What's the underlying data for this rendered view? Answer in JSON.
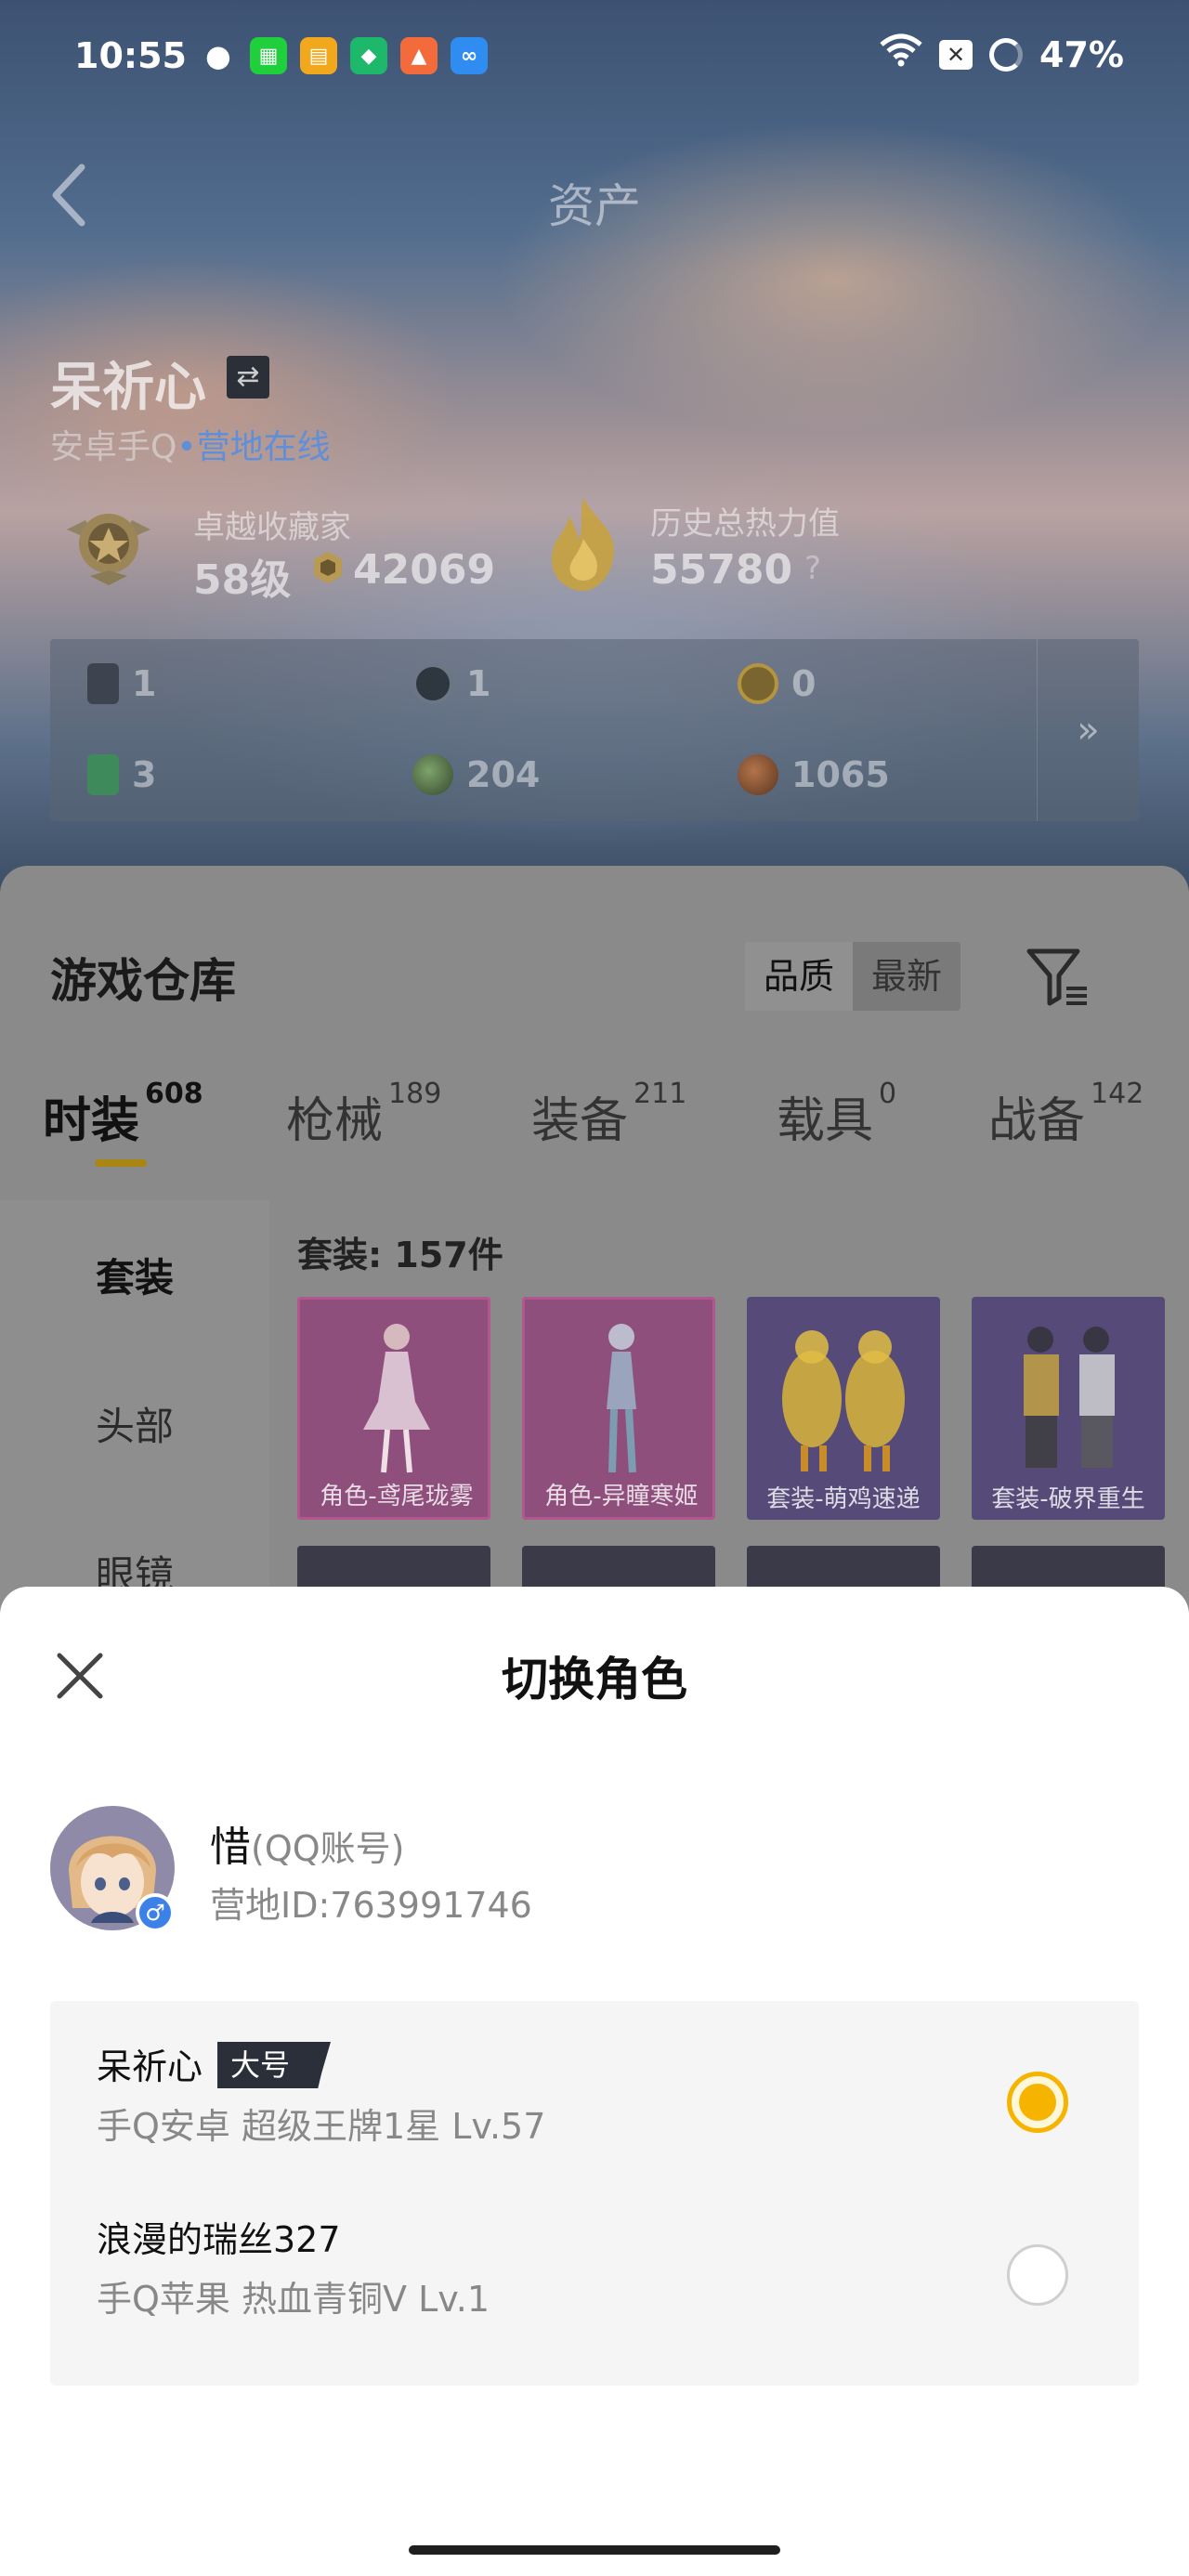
{
  "status_bar": {
    "time": "10:55",
    "battery": "47%",
    "app_icons": [
      "wechat-icon",
      "app-green-icon",
      "app-orange-icon",
      "shield-app-icon",
      "photo-app-icon",
      "cloud-app-icon"
    ]
  },
  "header": {
    "title": "资产"
  },
  "profile": {
    "name": "呆祈心",
    "platform": "安卓手Q",
    "online_dot": "•",
    "online_status": "营地在线",
    "rank_title": "卓越收藏家",
    "rank_level": "58级",
    "rank_score": "42069",
    "heat_title": "历史总热力值",
    "heat_value": "55780",
    "heat_help": "?"
  },
  "currencies": [
    {
      "icon": "card-icon",
      "value": "1"
    },
    {
      "icon": "coin-s-icon",
      "value": "1"
    },
    {
      "icon": "coin-gold-icon",
      "value": "0"
    },
    {
      "icon": "ticket-green-icon",
      "value": "3"
    },
    {
      "icon": "orb-green-icon",
      "value": "204"
    },
    {
      "icon": "coin-bronze-icon",
      "value": "1065"
    }
  ],
  "currency_more": "»",
  "warehouse": {
    "title": "游戏仓库",
    "sort_options": [
      "品质",
      "最新"
    ],
    "tabs": [
      {
        "label": "时装",
        "count": "608"
      },
      {
        "label": "枪械",
        "count": "189"
      },
      {
        "label": "装备",
        "count": "211"
      },
      {
        "label": "载具",
        "count": "0"
      },
      {
        "label": "战备",
        "count": "142"
      }
    ],
    "side_menu": [
      "套装",
      "头部",
      "眼镜"
    ],
    "suit_count": "套装: 157件",
    "cards": [
      {
        "label": "角色-鸢尾珑雾",
        "color": "#9a3f83"
      },
      {
        "label": "角色-异瞳寒姬",
        "color": "#9a3f83"
      },
      {
        "label": "套装-萌鸡速递",
        "color": "#4e3e78"
      },
      {
        "label": "套装-破界重生",
        "color": "#4e3e78"
      }
    ]
  },
  "modal": {
    "title": "切换角色",
    "account_name": "惜",
    "account_type": "(QQ账号)",
    "account_id": "营地ID:763991746",
    "gender": "♂",
    "roles": [
      {
        "name": "呆祈心",
        "tag": "大号",
        "meta": "手Q安卓  超级王牌1星  Lv.57",
        "selected": true
      },
      {
        "name": "浪漫的瑞丝327",
        "tag": "",
        "meta": "手Q苹果  热血青铜V  Lv.1",
        "selected": false
      }
    ]
  },
  "colors": {
    "accent": "#f6b400",
    "tab_underline": "#a98613",
    "online": "#5f8fd8"
  }
}
